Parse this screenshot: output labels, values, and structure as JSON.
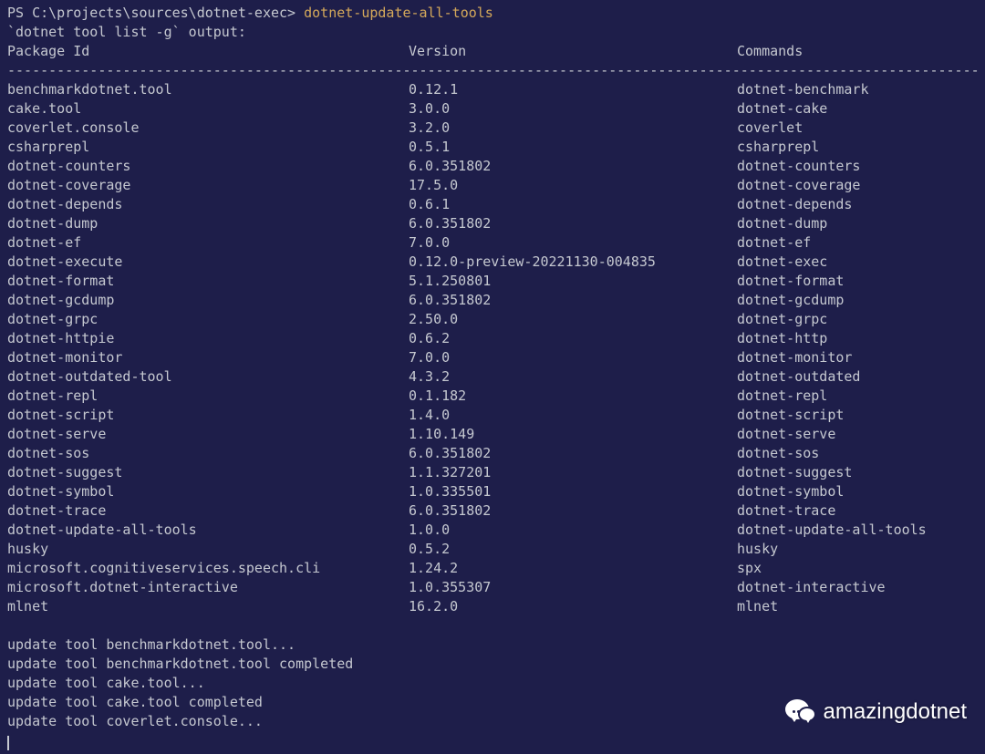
{
  "prompt": {
    "path": "PS C:\\projects\\sources\\dotnet-exec> ",
    "command": "dotnet-update-all-tools"
  },
  "output_header": "`dotnet tool list -g` output:",
  "columns": {
    "package": "Package Id",
    "version": "Version",
    "commands": "Commands"
  },
  "tools": [
    {
      "pkg": "benchmarkdotnet.tool",
      "ver": "0.12.1",
      "cmd": "dotnet-benchmark"
    },
    {
      "pkg": "cake.tool",
      "ver": "3.0.0",
      "cmd": "dotnet-cake"
    },
    {
      "pkg": "coverlet.console",
      "ver": "3.2.0",
      "cmd": "coverlet"
    },
    {
      "pkg": "csharprepl",
      "ver": "0.5.1",
      "cmd": "csharprepl"
    },
    {
      "pkg": "dotnet-counters",
      "ver": "6.0.351802",
      "cmd": "dotnet-counters"
    },
    {
      "pkg": "dotnet-coverage",
      "ver": "17.5.0",
      "cmd": "dotnet-coverage"
    },
    {
      "pkg": "dotnet-depends",
      "ver": "0.6.1",
      "cmd": "dotnet-depends"
    },
    {
      "pkg": "dotnet-dump",
      "ver": "6.0.351802",
      "cmd": "dotnet-dump"
    },
    {
      "pkg": "dotnet-ef",
      "ver": "7.0.0",
      "cmd": "dotnet-ef"
    },
    {
      "pkg": "dotnet-execute",
      "ver": "0.12.0-preview-20221130-004835",
      "cmd": "dotnet-exec"
    },
    {
      "pkg": "dotnet-format",
      "ver": "5.1.250801",
      "cmd": "dotnet-format"
    },
    {
      "pkg": "dotnet-gcdump",
      "ver": "6.0.351802",
      "cmd": "dotnet-gcdump"
    },
    {
      "pkg": "dotnet-grpc",
      "ver": "2.50.0",
      "cmd": "dotnet-grpc"
    },
    {
      "pkg": "dotnet-httpie",
      "ver": "0.6.2",
      "cmd": "dotnet-http"
    },
    {
      "pkg": "dotnet-monitor",
      "ver": "7.0.0",
      "cmd": "dotnet-monitor"
    },
    {
      "pkg": "dotnet-outdated-tool",
      "ver": "4.3.2",
      "cmd": "dotnet-outdated"
    },
    {
      "pkg": "dotnet-repl",
      "ver": "0.1.182",
      "cmd": "dotnet-repl"
    },
    {
      "pkg": "dotnet-script",
      "ver": "1.4.0",
      "cmd": "dotnet-script"
    },
    {
      "pkg": "dotnet-serve",
      "ver": "1.10.149",
      "cmd": "dotnet-serve"
    },
    {
      "pkg": "dotnet-sos",
      "ver": "6.0.351802",
      "cmd": "dotnet-sos"
    },
    {
      "pkg": "dotnet-suggest",
      "ver": "1.1.327201",
      "cmd": "dotnet-suggest"
    },
    {
      "pkg": "dotnet-symbol",
      "ver": "1.0.335501",
      "cmd": "dotnet-symbol"
    },
    {
      "pkg": "dotnet-trace",
      "ver": "6.0.351802",
      "cmd": "dotnet-trace"
    },
    {
      "pkg": "dotnet-update-all-tools",
      "ver": "1.0.0",
      "cmd": "dotnet-update-all-tools"
    },
    {
      "pkg": "husky",
      "ver": "0.5.2",
      "cmd": "husky"
    },
    {
      "pkg": "microsoft.cognitiveservices.speech.cli",
      "ver": "1.24.2",
      "cmd": "spx"
    },
    {
      "pkg": "microsoft.dotnet-interactive",
      "ver": "1.0.355307",
      "cmd": "dotnet-interactive"
    },
    {
      "pkg": "mlnet",
      "ver": "16.2.0",
      "cmd": "mlnet"
    }
  ],
  "updates": [
    "update tool benchmarkdotnet.tool...",
    "update tool benchmarkdotnet.tool completed",
    "update tool cake.tool...",
    "update tool cake.tool completed",
    "update tool coverlet.console..."
  ],
  "watermark": {
    "text": "amazingdotnet"
  }
}
